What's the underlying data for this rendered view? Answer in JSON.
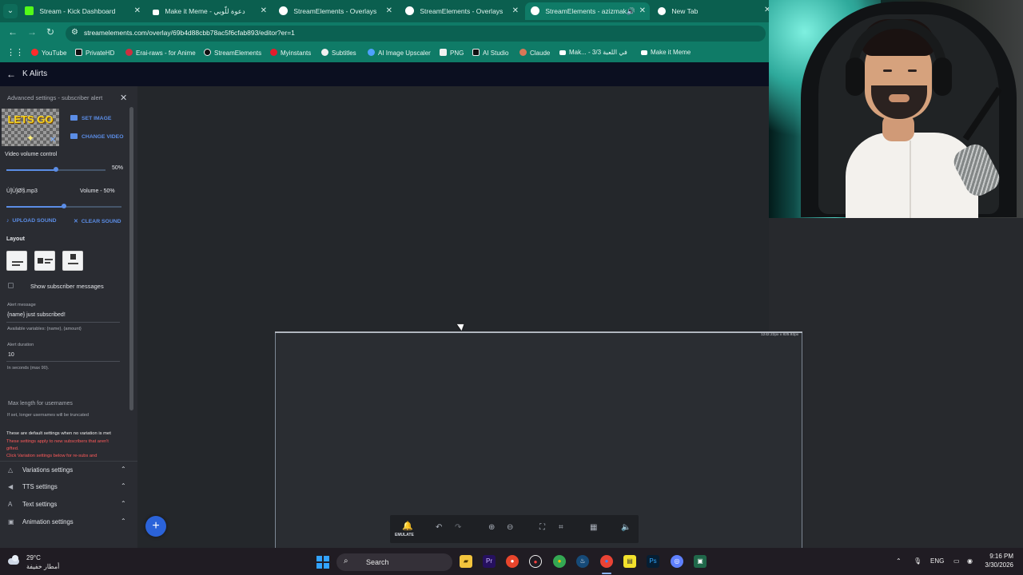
{
  "browser": {
    "tabs": [
      {
        "title": "Stream - Kick Dashboard",
        "icon": "kick-icon",
        "color": "#53fc18"
      },
      {
        "title": "Make it Meme - دعوة للّوبي",
        "icon": "meme-icon",
        "color": "#ffffff"
      },
      {
        "title": "StreamElements - Overlays",
        "icon": "streamelements-icon",
        "color": "#ffffff"
      },
      {
        "title": "StreamElements - Overlays",
        "icon": "streamelements-icon",
        "color": "#ffffff"
      },
      {
        "title": "StreamElements - azizmak",
        "icon": "streamelements-icon",
        "color": "#ffffff"
      },
      {
        "title": "New Tab",
        "icon": "chrome-icon",
        "color": "#ffffff"
      }
    ],
    "url": "streamelements.com/overlay/69b4d88cbb78ac5f6cfab893/editor?er=1",
    "bookmarks": [
      {
        "label": "YouTube",
        "icon": "youtube-icon",
        "color": "#ff2b2b"
      },
      {
        "label": "PrivateHD",
        "icon": "hd-icon",
        "color": "#111111"
      },
      {
        "label": "Erai-raws - for Anime",
        "icon": "erai-icon",
        "color": "#cc3040"
      },
      {
        "label": "StreamElements",
        "icon": "streamelements-icon",
        "color": "#111111"
      },
      {
        "label": "Myinstants",
        "icon": "myinstants-icon",
        "color": "#e41c2c"
      },
      {
        "label": "Subtitles",
        "icon": "subtitles-icon",
        "color": "#f0f0f0"
      },
      {
        "label": "AI Image Upscaler",
        "icon": "upscaler-icon",
        "color": "#4ea1ff"
      },
      {
        "label": "PNG",
        "icon": "png-icon",
        "color": "#f0f0f0"
      },
      {
        "label": "AI Studio",
        "icon": "aistudio-icon",
        "color": "#111111"
      },
      {
        "label": "Claude",
        "icon": "claude-icon",
        "color": "#d97757"
      },
      {
        "label": "Mak... - 3/3 في اللعبة",
        "icon": "meme-icon",
        "color": "#ffffff"
      },
      {
        "label": "Make it Meme",
        "icon": "meme-icon",
        "color": "#ffffff"
      }
    ]
  },
  "editor": {
    "overlay_name": "K Alirts",
    "panel_title": "Advanced settings - subscriber alert",
    "thumbnail_text": "LETS GO",
    "set_image": "SET IMAGE",
    "change_video": "CHANGE VIDEO",
    "video_volume_label": "Video volume control",
    "video_volume_value": "50%",
    "video_volume_fraction": 0.5,
    "sound_name": "Ù]Ù]Ø§.mp3",
    "sound_volume": "Volume - 50%",
    "sound_volume_fraction": 0.5,
    "upload_sound": "UPLOAD SOUND",
    "clear_sound": "CLEAR SOUND",
    "layout_label": "Layout",
    "show_messages": "Show subscriber messages",
    "alert_message_label": "Alert message",
    "alert_message_value": "{name} just subscribed!",
    "variables_note": "Available variables: {name}, {amount}",
    "duration_label": "Alert duration",
    "duration_value": "10",
    "duration_note": "In seconds (max 90).",
    "max_length_label": "Max length for usernames",
    "max_length_note": "If set, longer usernames will be truncated",
    "default_settings_note": "These are default settings when no variation is met",
    "warning_1": "These settings apply to new subscribers that aren't gifted.",
    "warning_2": "Click Variation settings below for re-subs and",
    "sections": [
      {
        "label": "Variations settings",
        "icon": "variations-icon"
      },
      {
        "label": "TTS settings",
        "icon": "speaker-icon"
      },
      {
        "label": "Text settings",
        "icon": "text-icon"
      },
      {
        "label": "Animation settings",
        "icon": "animation-icon"
      }
    ],
    "canvas_dimensions": "1242.22px x 825.92px",
    "emulate_label": "EMULATE"
  },
  "taskbar": {
    "temperature": "29°C",
    "weather": "أمطار خفيفة",
    "search_placeholder": "Search",
    "language": "ENG",
    "time": "9:16 PM",
    "date": "3/30/2026"
  },
  "colors": {
    "browser_tab_bar": "#0b5f4f",
    "browser_toolbar": "#0f7b67",
    "editor_header": "#0b0f20",
    "sidebar": "#2a2c32",
    "accent_blue": "#5b8de6",
    "warning_red": "#ff5a5a",
    "fab_blue": "#2b63d9"
  }
}
